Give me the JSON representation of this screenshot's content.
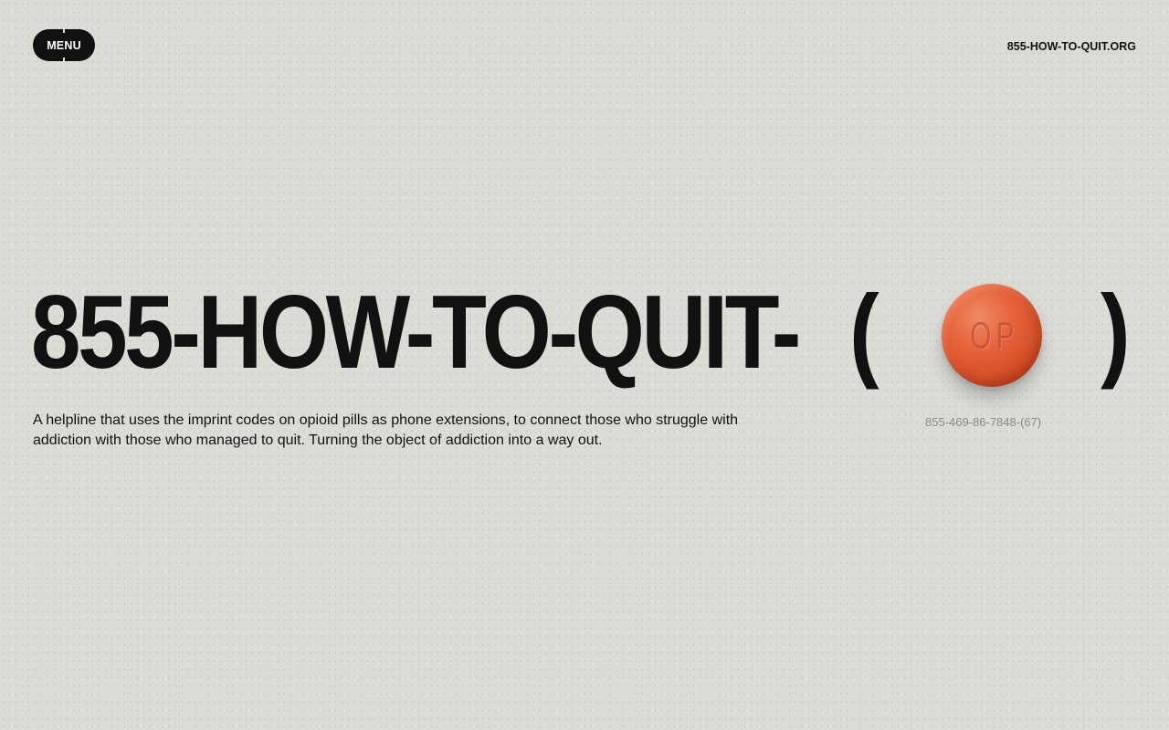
{
  "header": {
    "menu_label": "MENU",
    "site_link": "855-HOW-TO-QUIT.ORG"
  },
  "hero": {
    "headline": "855-HOW-TO-QUIT-",
    "paren_open": "(",
    "paren_close": ")",
    "pill": {
      "imprint": "OP",
      "color": "#e0582f"
    },
    "phone_extension": "855-469-86-7848-(67)",
    "description": "A helpline that uses the imprint codes on opioid pills as phone extensions, to connect those who struggle with addiction with those who managed to quit. Turning the object of addiction into a way out."
  },
  "colors": {
    "background": "#dcdcd7",
    "text": "#111111",
    "muted": "#8a8a86"
  }
}
